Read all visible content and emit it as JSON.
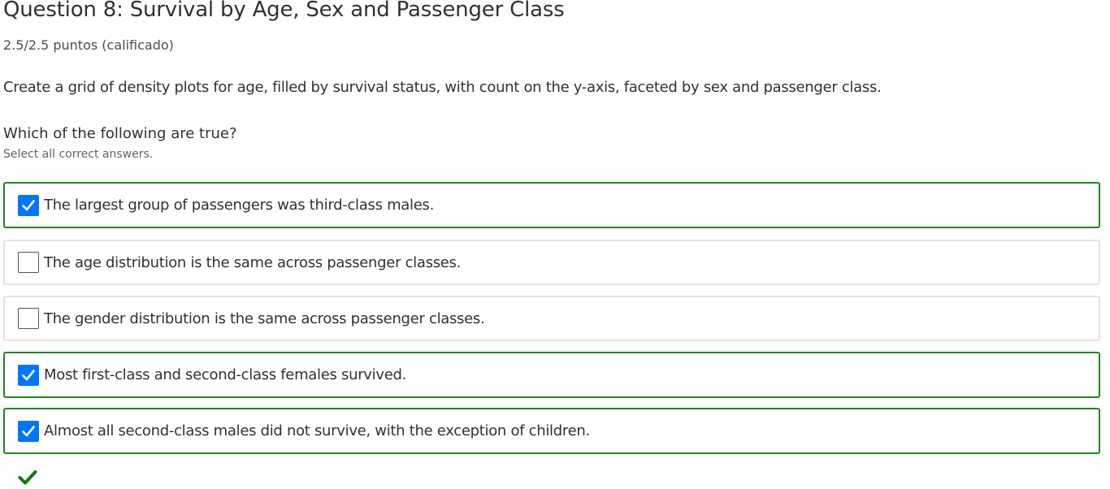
{
  "question": {
    "title": "Question 8: Survival by Age, Sex and Passenger Class",
    "points": "2.5/2.5 puntos (calificado)",
    "prompt": "Create a grid of density plots for age, filled by survival status, with count on the y-axis, faceted by sex and passenger class.",
    "ask": "Which of the following are true?",
    "hint": "Select all correct answers."
  },
  "options": [
    {
      "label": "The largest group of passengers was third-class males.",
      "checked": true,
      "correct": true
    },
    {
      "label": "The age distribution is the same across passenger classes.",
      "checked": false,
      "correct": false
    },
    {
      "label": "The gender distribution is the same across passenger classes.",
      "checked": false,
      "correct": false
    },
    {
      "label": "Most first-class and second-class females survived.",
      "checked": true,
      "correct": true
    },
    {
      "label": "Almost all second-class males did not survive, with the exception of children.",
      "checked": true,
      "correct": true
    }
  ],
  "result": {
    "icon": "checkmark-icon",
    "status": "correct"
  },
  "colors": {
    "correct_border": "#1a8a1a",
    "neutral_border": "#e3e3e3",
    "checkbox_checked": "#0075ff",
    "checkmark_green": "#0d7a0d"
  }
}
